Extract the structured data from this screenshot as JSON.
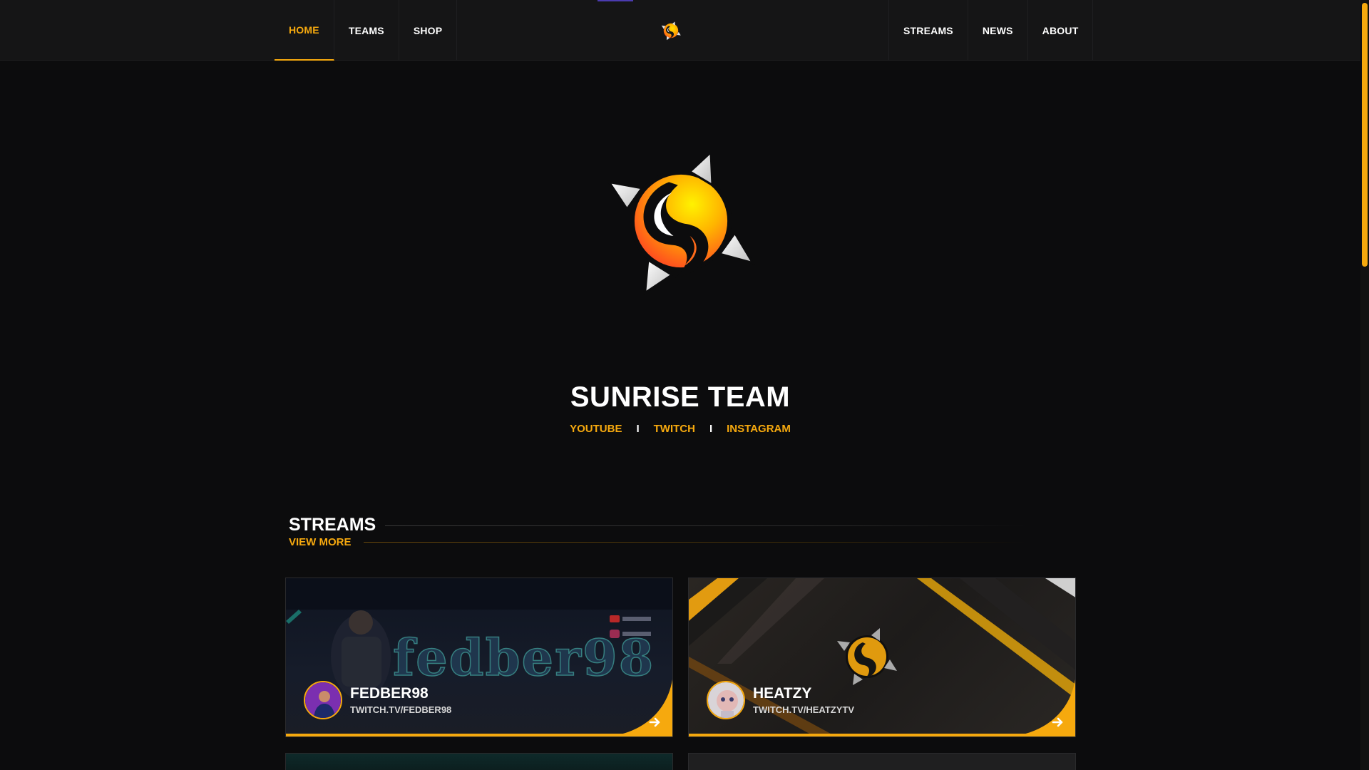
{
  "nav": {
    "left_items": [
      {
        "label": "HOME",
        "active": true
      },
      {
        "label": "TEAMS"
      },
      {
        "label": "SHOP"
      }
    ],
    "right_items": [
      {
        "label": "STREAMS"
      },
      {
        "label": "NEWS"
      },
      {
        "label": "ABOUT"
      }
    ],
    "logo_icon": "sunrise-logo-icon"
  },
  "hero": {
    "title": "SUNRISE TEAM",
    "socials": [
      "YOUTUBE",
      "TWITCH",
      "INSTAGRAM"
    ],
    "separator": "I"
  },
  "streams": {
    "title": "STREAMS",
    "view_more": "VIEW MORE",
    "cards": [
      {
        "name": "FEDBER98",
        "url": "TWITCH.TV/FEDBER98",
        "banner_text": "fedber98"
      },
      {
        "name": "HEATZY",
        "url": "TWITCH.TV/HEATZYTV"
      }
    ]
  },
  "colors": {
    "accent": "#f6a90e",
    "background": "#0c0c0d",
    "nav_background": "#151516"
  }
}
